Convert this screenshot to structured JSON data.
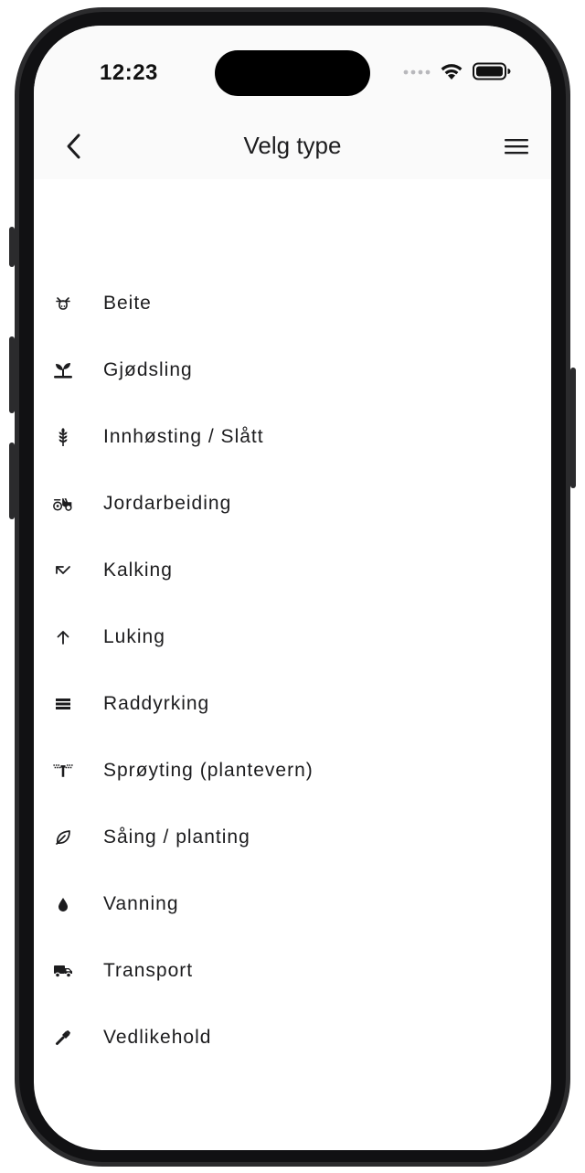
{
  "status_bar": {
    "time": "12:23"
  },
  "nav": {
    "title": "Velg type",
    "back_icon": "chevron-left-icon",
    "menu_icon": "hamburger-menu-icon"
  },
  "colors": {
    "text": "#1c1c1e",
    "header_bg": "#fafafa",
    "icon": "#1c1c1e"
  },
  "items": [
    {
      "label": "Beite",
      "icon": "cow-icon"
    },
    {
      "label": "Gjødsling",
      "icon": "sprout-icon"
    },
    {
      "label": "Innhøsting / Slått",
      "icon": "wheat-icon"
    },
    {
      "label": "Jordarbeiding",
      "icon": "tractor-icon"
    },
    {
      "label": "Kalking",
      "icon": "trend-arrow-icon"
    },
    {
      "label": "Luking",
      "icon": "arrow-up-icon"
    },
    {
      "label": "Raddyrking",
      "icon": "rows-icon"
    },
    {
      "label": "Sprøyting (plantevern)",
      "icon": "sprayer-icon"
    },
    {
      "label": "Såing / planting",
      "icon": "leaf-icon"
    },
    {
      "label": "Vanning",
      "icon": "water-drop-icon"
    },
    {
      "label": "Transport",
      "icon": "truck-icon"
    },
    {
      "label": "Vedlikehold",
      "icon": "hammer-icon"
    }
  ]
}
